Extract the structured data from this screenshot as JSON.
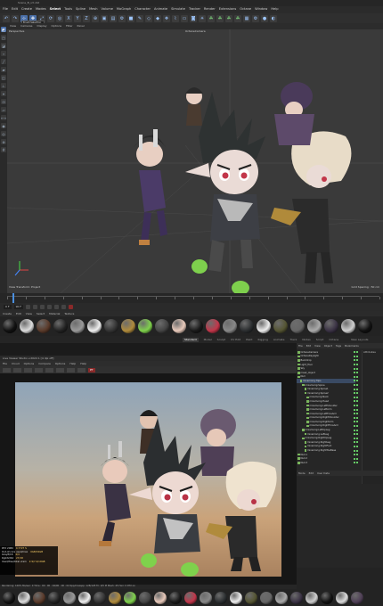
{
  "window": {
    "title": "Scene_B_v3.c4d"
  },
  "menubar": [
    "File",
    "Edit",
    "Create",
    "Modes",
    "Select",
    "Tools",
    "Spline",
    "Mesh",
    "Volume",
    "MoGraph",
    "Character",
    "Animate",
    "Simulate",
    "Tracker",
    "Render",
    "Extensions",
    "Octane",
    "Window",
    "Help"
  ],
  "tooltip": {
    "line1": "Brush Selection",
    "line2": "Brush Selection"
  },
  "viewport": {
    "menu": [
      "View",
      "Cameras",
      "Display",
      "Options",
      "Filter",
      "Panel"
    ],
    "label": "Perspective",
    "camera": "OctaneCamera",
    "status_left": "View Transform: Project",
    "status_right": "Grid Spacing : 50 cm"
  },
  "timeline": {
    "current_frame": "0 F",
    "end_frame": "90 F"
  },
  "material_menu": [
    "Create",
    "Edit",
    "View",
    "Select",
    "Material",
    "Texture"
  ],
  "layout_tabs": {
    "items": [
      "Standard",
      "Model",
      "Sculpt",
      "UV Edit",
      "Paint",
      "Rigging",
      "Animate",
      "Track",
      "Nodes",
      "Script",
      "Octane"
    ],
    "selected": "Standard",
    "extra": "New Layouts"
  },
  "render_window": {
    "title": "Live Viewer Studio v.2022.1 [4 dpi off]",
    "menu": [
      "File",
      "Cloud",
      "Options",
      "Compare",
      "Options",
      "Help",
      "Help"
    ],
    "tag": "PT",
    "stats": [
      {
        "label": "RTX 2080",
        "value": "0.7727 S"
      },
      {
        "label": "Out-of-core used/max",
        "value": "0GB/32GB"
      },
      {
        "label": "Grey8/16",
        "value": "4/4"
      },
      {
        "label": "Rgb32/64",
        "value": "27/18"
      },
      {
        "label": "Used/free/total vram",
        "value": "2.9/7.4/10GB"
      }
    ],
    "status": "Rendering: 100%  Ms/sec: 0  Time : 00 : 00 : 04/00 : 00 : 04  Spp/maxspp: 128/128  Tri: 0/5 M  Mesh: 45  Hair: 0  RTX:on"
  },
  "object_manager": {
    "menu": [
      "File",
      "Edit",
      "View",
      "Object",
      "Tags",
      "Bookmarks"
    ],
    "items": [
      {
        "name": "OctaneCamera",
        "depth": 0
      },
      {
        "name": "OctaneDaylight",
        "depth": 0
      },
      {
        "name": "Backdrop",
        "depth": 0
      },
      {
        "name": "Light_floor",
        "depth": 0
      },
      {
        "name": "Sky",
        "depth": 0
      },
      {
        "name": "mask_object",
        "depth": 0
      },
      {
        "name": "Null",
        "depth": 0
      },
      {
        "name": "mixamorig:Hips",
        "depth": 1
      },
      {
        "name": "mixamorig:Spine",
        "depth": 2
      },
      {
        "name": "mixamorig:Spine1",
        "depth": 3
      },
      {
        "name": "mixamorig:Spine2",
        "depth": 3
      },
      {
        "name": "mixamorig:Neck",
        "depth": 4
      },
      {
        "name": "mixamorig:Head",
        "depth": 4
      },
      {
        "name": "mixamorig:LeftShoulder",
        "depth": 4
      },
      {
        "name": "mixamorig:LeftArm",
        "depth": 4
      },
      {
        "name": "mixamorig:LeftForeArm",
        "depth": 4
      },
      {
        "name": "mixamorig:RightShoulder",
        "depth": 4
      },
      {
        "name": "mixamorig:RightArm",
        "depth": 4
      },
      {
        "name": "mixamorig:RightForeArm",
        "depth": 4
      },
      {
        "name": "mixamorig:LeftUpLeg",
        "depth": 2
      },
      {
        "name": "mixamorig:LeftLeg",
        "depth": 3
      },
      {
        "name": "mixamorig:RightUpLeg",
        "depth": 2
      },
      {
        "name": "mixamorig:RightLeg",
        "depth": 3
      },
      {
        "name": "mixamorig:RightFoot",
        "depth": 3
      },
      {
        "name": "mixamorig:RightToeBase",
        "depth": 3
      },
      {
        "name": "Null.1",
        "depth": 0
      },
      {
        "name": "Null.2",
        "depth": 0
      },
      {
        "name": "Null.3",
        "depth": 0
      }
    ],
    "attr_tab": "Attributes",
    "attr_menu": [
      "Mode",
      "Edit",
      "User Data"
    ]
  },
  "colors": {
    "accent": "#4a8fe0",
    "viewport_bg": "#3a3a3a",
    "selected": "#3a4a63"
  }
}
